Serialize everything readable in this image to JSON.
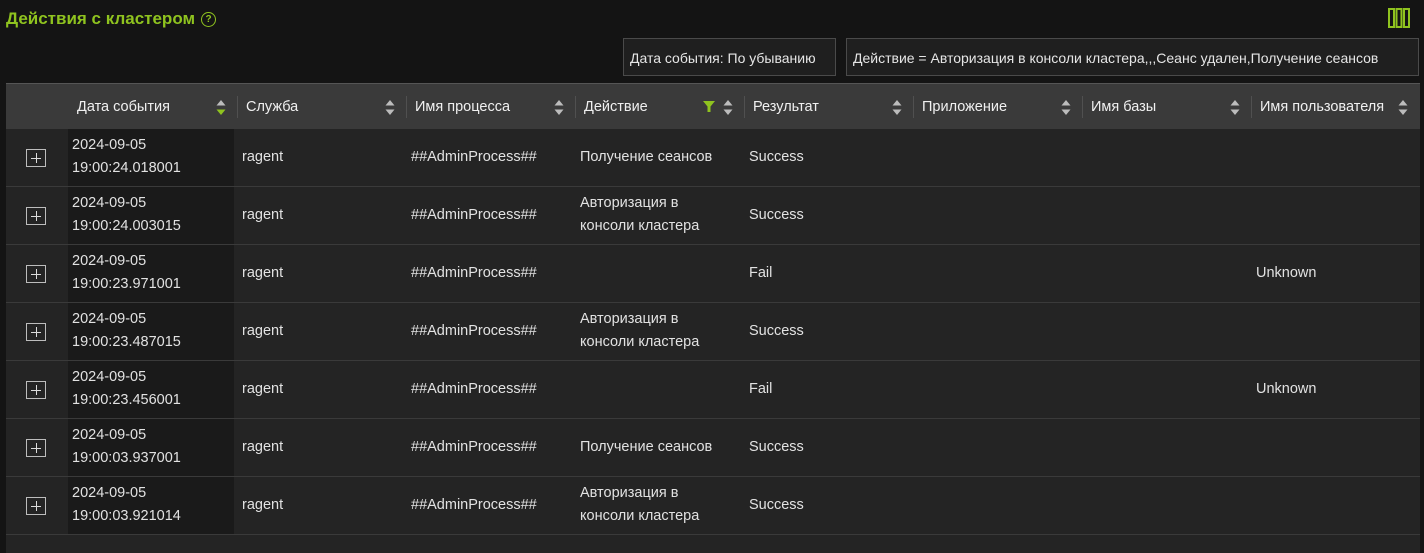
{
  "header": {
    "title": "Действия с кластером",
    "help": "?"
  },
  "chips": {
    "sort": "Дата события: По убыванию",
    "filter": "Действие = Авторизация в консоли кластера,,,Сеанс удален,Получение сеансов"
  },
  "columns": [
    "Дата события",
    "Служба",
    "Имя процесса",
    "Действие",
    "Результат",
    "Приложение",
    "Имя базы",
    "Имя пользователя"
  ],
  "accent_color": "#8fc31f",
  "rows": [
    {
      "date": "2024-09-05",
      "time": "19:00:24.018001",
      "service": "ragent",
      "process": "##AdminProcess##",
      "action": [
        "Получение сеансов"
      ],
      "result": "Success",
      "app": "",
      "db": "",
      "user": ""
    },
    {
      "date": "2024-09-05",
      "time": "19:00:24.003015",
      "service": "ragent",
      "process": "##AdminProcess##",
      "action": [
        "Авторизация в",
        "консоли кластера"
      ],
      "result": "Success",
      "app": "",
      "db": "",
      "user": ""
    },
    {
      "date": "2024-09-05",
      "time": "19:00:23.971001",
      "service": "ragent",
      "process": "##AdminProcess##",
      "action": [],
      "result": "Fail",
      "app": "",
      "db": "",
      "user": "Unknown"
    },
    {
      "date": "2024-09-05",
      "time": "19:00:23.487015",
      "service": "ragent",
      "process": "##AdminProcess##",
      "action": [
        "Авторизация в",
        "консоли кластера"
      ],
      "result": "Success",
      "app": "",
      "db": "",
      "user": ""
    },
    {
      "date": "2024-09-05",
      "time": "19:00:23.456001",
      "service": "ragent",
      "process": "##AdminProcess##",
      "action": [],
      "result": "Fail",
      "app": "",
      "db": "",
      "user": "Unknown"
    },
    {
      "date": "2024-09-05",
      "time": "19:00:03.937001",
      "service": "ragent",
      "process": "##AdminProcess##",
      "action": [
        "Получение сеансов"
      ],
      "result": "Success",
      "app": "",
      "db": "",
      "user": ""
    },
    {
      "date": "2024-09-05",
      "time": "19:00:03.921014",
      "service": "ragent",
      "process": "##AdminProcess##",
      "action": [
        "Авторизация в",
        "консоли кластера"
      ],
      "result": "Success",
      "app": "",
      "db": "",
      "user": ""
    }
  ]
}
